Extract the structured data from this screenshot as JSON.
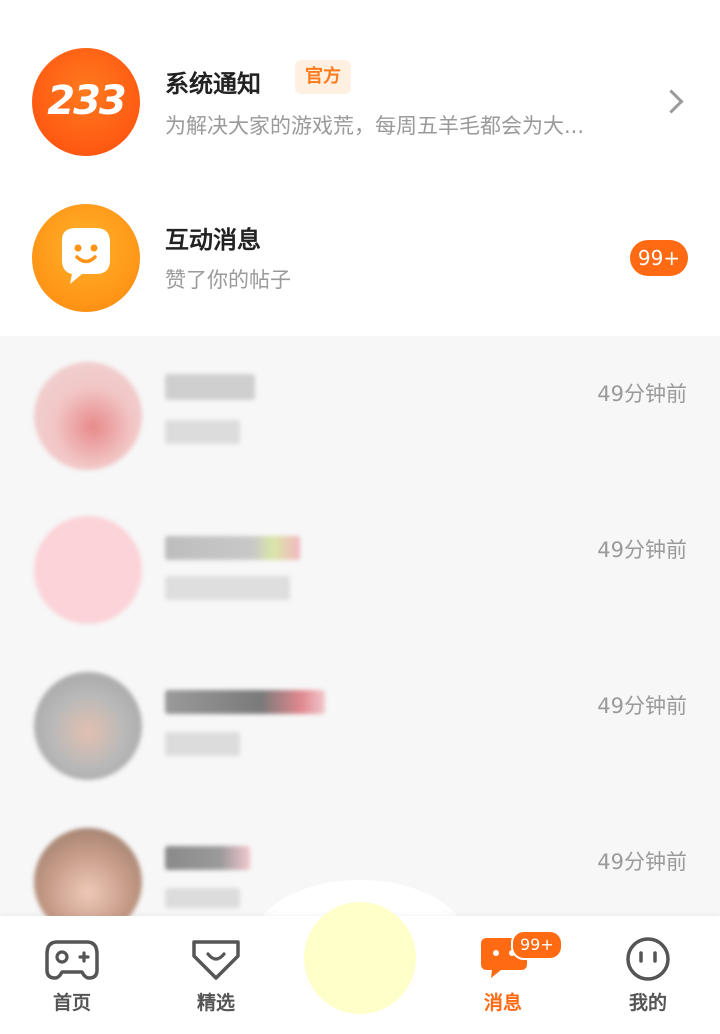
{
  "system_notice": {
    "avatar_text": "233",
    "title": "系统通知",
    "tag": "官方",
    "preview": "为解决大家的游戏荒，每周五羊毛都会为大..."
  },
  "interaction": {
    "title": "互动消息",
    "preview": "赞了你的帖子",
    "badge": "99+"
  },
  "chats": [
    {
      "time": "49分钟前"
    },
    {
      "time": "49分钟前"
    },
    {
      "time": "49分钟前"
    },
    {
      "time": "49分钟前"
    }
  ],
  "tabbar": {
    "items": [
      {
        "label": "首页",
        "icon": "gamepad-icon"
      },
      {
        "label": "精选",
        "icon": "heart-badge-icon"
      },
      {
        "label": "消息",
        "icon": "chat-bubble-icon",
        "badge": "99+",
        "active": true
      },
      {
        "label": "我的",
        "icon": "face-icon"
      }
    ]
  },
  "colors": {
    "accent": "#ff6a13",
    "tag_bg": "#fff0e2",
    "center_button": "#ffffc9"
  }
}
